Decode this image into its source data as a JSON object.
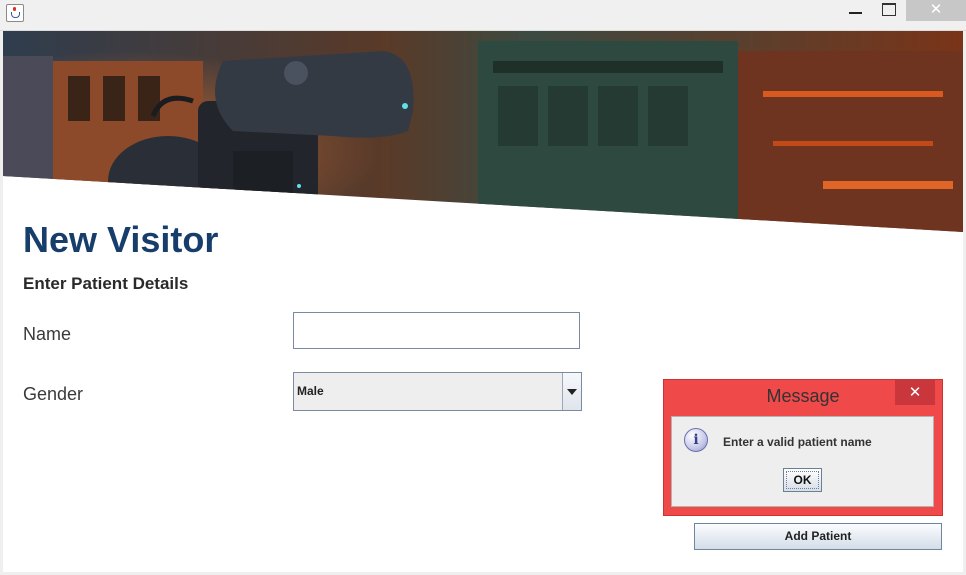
{
  "window": {
    "close_glyph": "✕"
  },
  "form": {
    "title": "New Visitor",
    "subtitle": "Enter Patient Details",
    "name_label": "Name",
    "name_value": "",
    "gender_label": "Gender",
    "gender_value": "Male",
    "add_button": "Add Patient"
  },
  "dialog": {
    "title": "Message",
    "close_glyph": "✕",
    "icon": "i",
    "message": "Enter a valid patient name",
    "ok_label": "OK"
  },
  "colors": {
    "heading": "#173d6b",
    "dialog_border": "#f0494a",
    "dialog_close": "#c9373c"
  }
}
